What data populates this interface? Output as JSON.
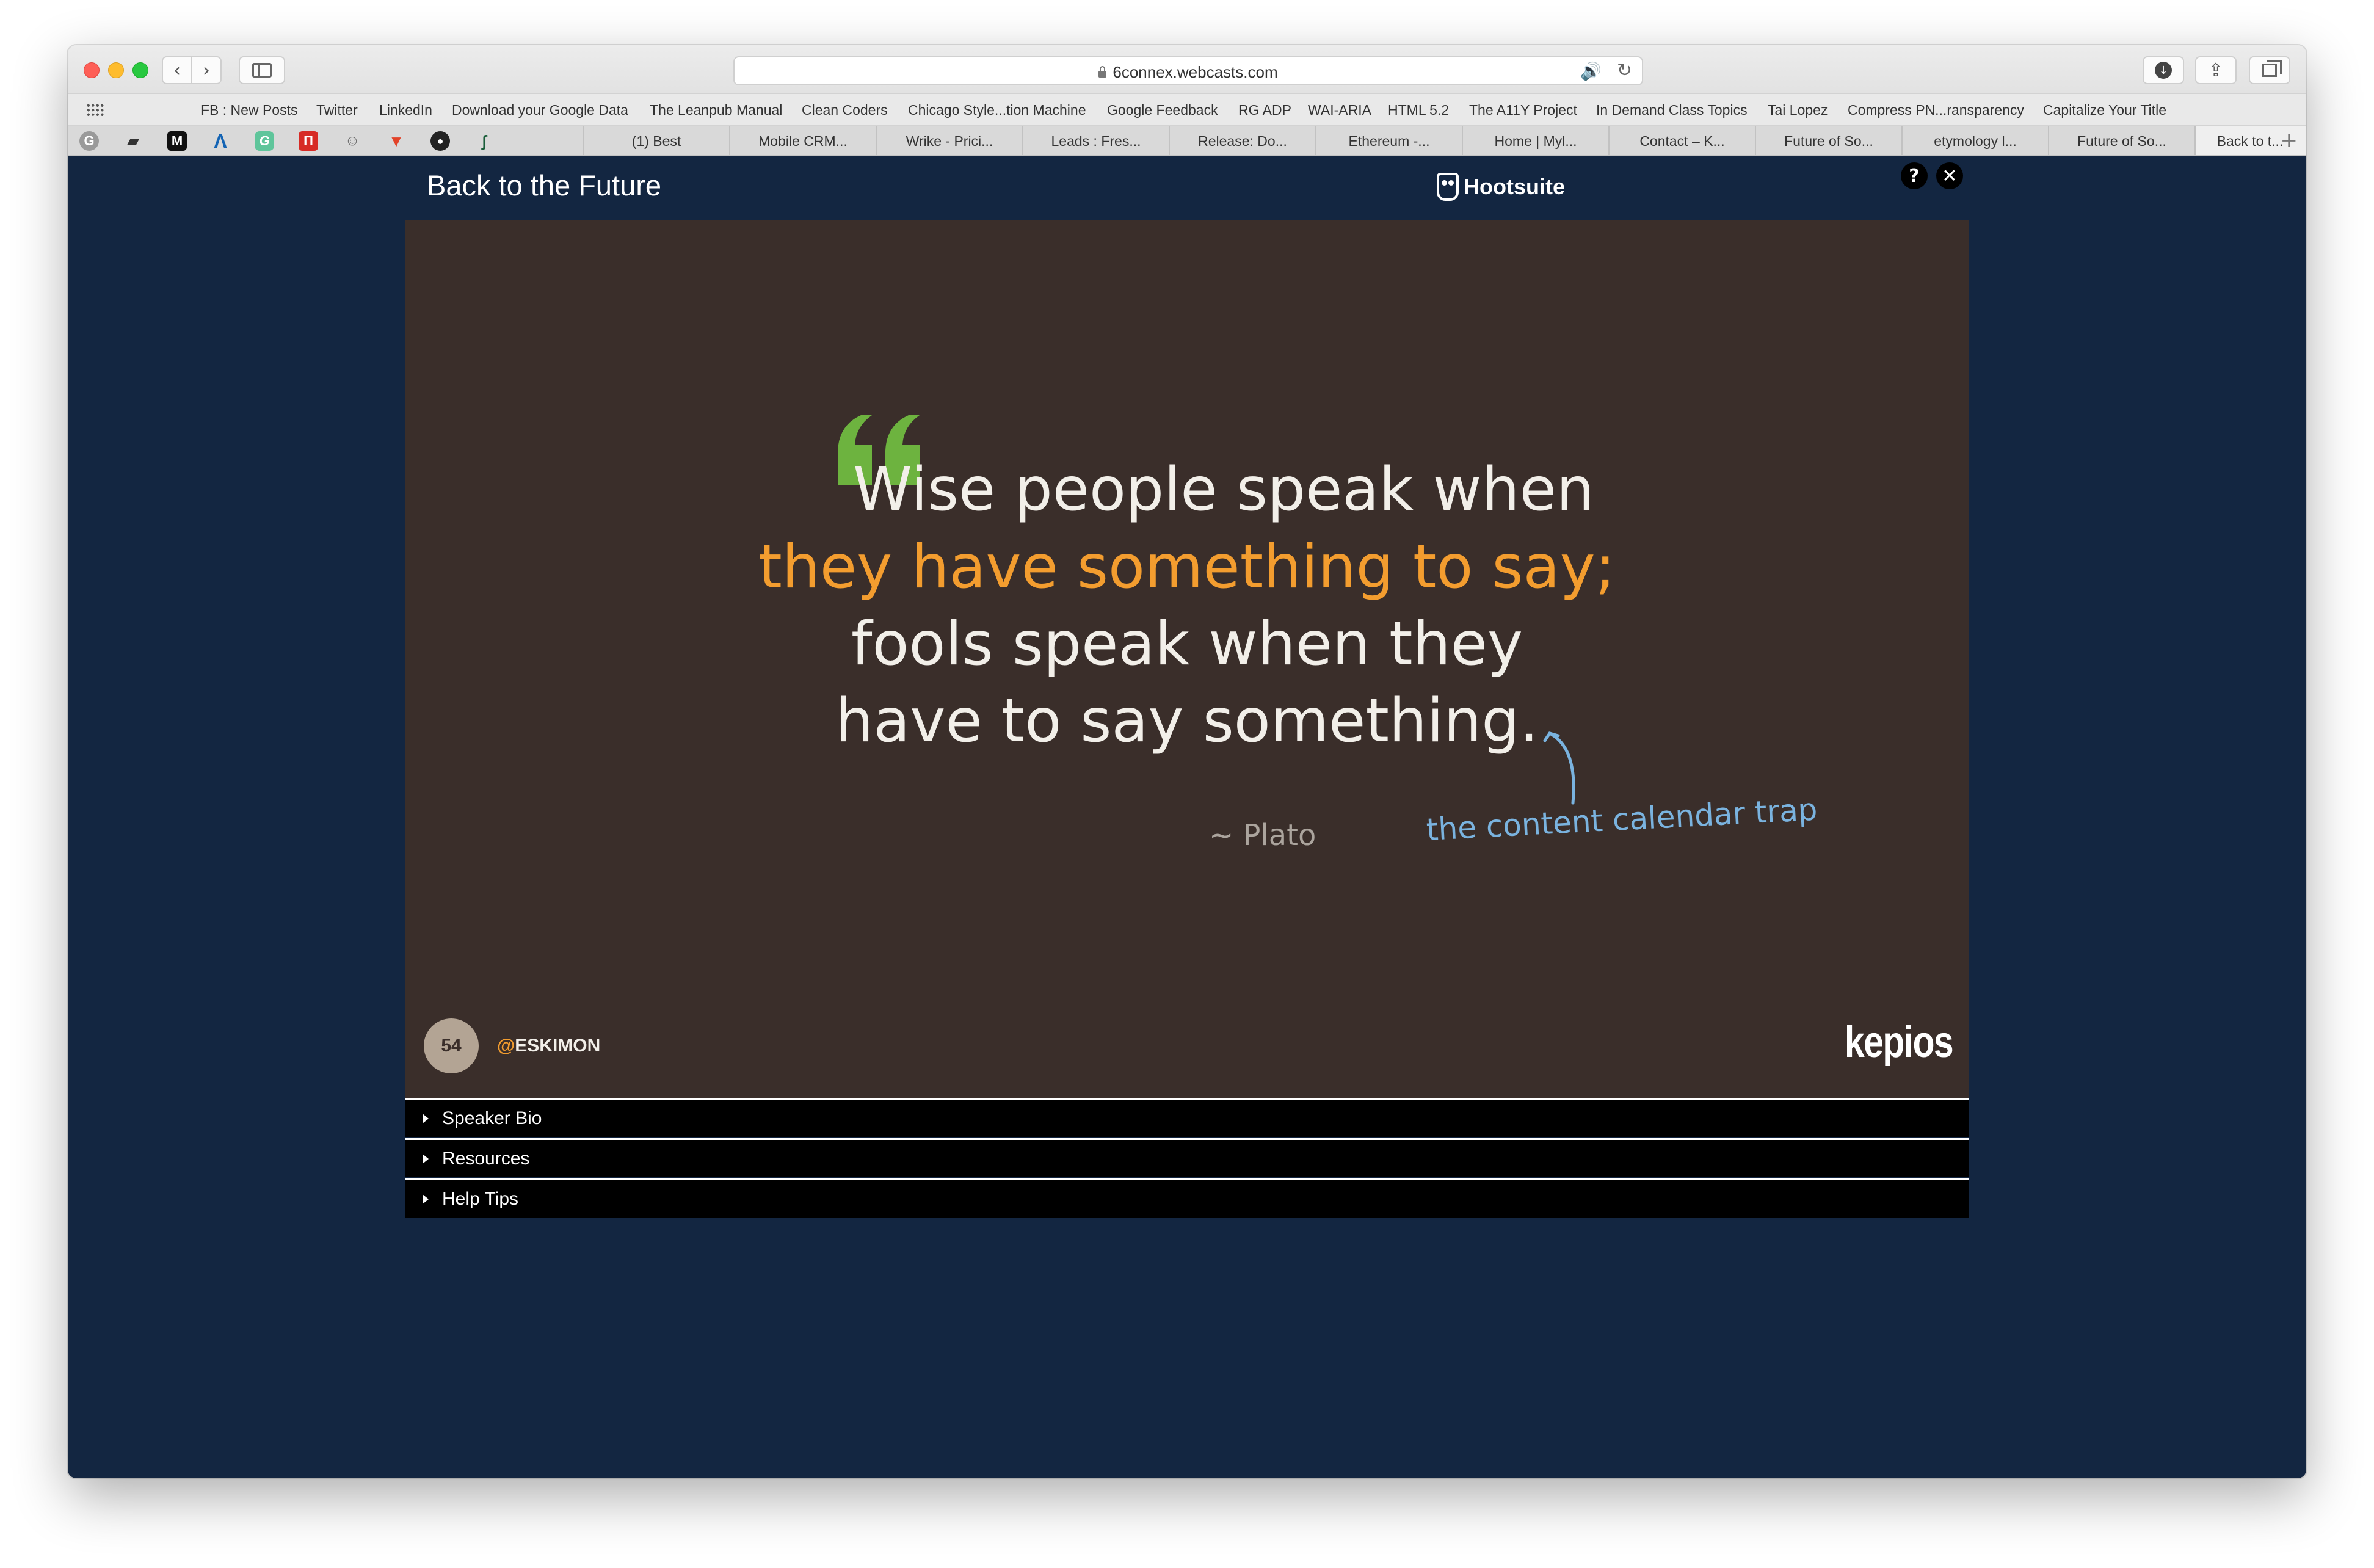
{
  "browser": {
    "url": "6connex.webcasts.com",
    "bookmarks": [
      "FB : New Posts",
      "Twitter",
      "LinkedIn",
      "Download your Google Data",
      "The Leanpub Manual",
      "Clean Coders",
      "Chicago Style...tion Machine",
      "Google Feedback",
      "RG ADP",
      "WAI-ARIA",
      "HTML 5.2",
      "The A11Y Project",
      "In Demand Class Topics",
      "Tai Lopez",
      "Compress PN...ransparency",
      "Capitalize Your Title"
    ],
    "pinned_icons": [
      "grammarly-icon",
      "reader-icon",
      "medium-icon",
      "autodesk-icon",
      "grammarly-g-icon",
      "todoist-icon",
      "alien-icon",
      "gitlab-icon",
      "github-icon",
      "fancy-icon"
    ],
    "tabs": [
      "(1) Best",
      "Mobile CRM...",
      "Wrike - Prici...",
      "Leads : Fres...",
      "Release: Do...",
      "Ethereum -...",
      "Home | Myl...",
      "Contact – K...",
      "Future of So...",
      "etymology l...",
      "Future of So...",
      "Back to t..."
    ],
    "active_tab_index": 11
  },
  "player": {
    "title": "Back to the Future",
    "brand": "Hootsuite",
    "help_label": "?",
    "close_label": "✕"
  },
  "slide": {
    "quote_line1": "Wise people speak when",
    "quote_line2": "they have something to say;",
    "quote_line3": "fools speak when they",
    "quote_line4": "have to say something.",
    "attribution": "~ Plato",
    "annotation": "the content calendar trap",
    "slide_number": "54",
    "handle_at": "@",
    "handle": "ESKIMON",
    "logo_text": "kepios",
    "colors": {
      "background": "#3a2e2a",
      "highlight": "#f39d2f",
      "quote_mark": "#6db33f",
      "annotation": "#7ab3df"
    }
  },
  "panels": [
    {
      "label": "Speaker Bio"
    },
    {
      "label": "Resources"
    },
    {
      "label": "Help Tips"
    }
  ]
}
